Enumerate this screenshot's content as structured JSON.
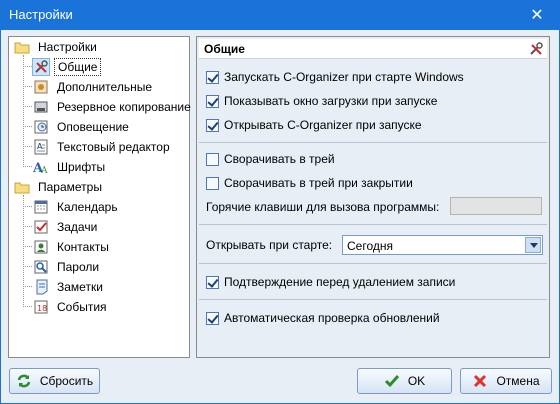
{
  "window": {
    "title": "Настройки",
    "close_glyph": "✕"
  },
  "tree": {
    "root1": "Настройки",
    "root1_children": [
      {
        "label": "Общие",
        "icon": "wrench-screwdriver-icon",
        "selected": true
      },
      {
        "label": "Дополнительные",
        "icon": "gear-icon"
      },
      {
        "label": "Резервное копирование",
        "icon": "backup-icon"
      },
      {
        "label": "Оповещение",
        "icon": "clock-icon"
      },
      {
        "label": "Текстовый редактор",
        "icon": "text-editor-icon"
      },
      {
        "label": "Шрифты",
        "icon": "font-icon"
      }
    ],
    "root2": "Параметры",
    "root2_children": [
      {
        "label": "Календарь",
        "icon": "calendar-icon"
      },
      {
        "label": "Задачи",
        "icon": "tasks-icon"
      },
      {
        "label": "Контакты",
        "icon": "contacts-icon"
      },
      {
        "label": "Пароли",
        "icon": "passwords-icon"
      },
      {
        "label": "Заметки",
        "icon": "notes-icon"
      },
      {
        "label": "События",
        "icon": "events-icon"
      }
    ]
  },
  "panel": {
    "title": "Общие",
    "opt_startup": {
      "label": "Запускать C-Organizer при старте Windows",
      "checked": true
    },
    "opt_splash": {
      "label": "Показывать окно загрузки при запуске",
      "checked": true
    },
    "opt_open": {
      "label": "Открывать C-Organizer при запуске",
      "checked": true
    },
    "opt_tray": {
      "label": "Сворачивать в трей",
      "checked": false
    },
    "opt_tray_close": {
      "label": "Сворачивать в трей при закрытии",
      "checked": false
    },
    "hotkey_label": "Горячие клавиши для вызова программы:",
    "hotkey_value": "",
    "open_label": "Открывать при старте:",
    "open_value": "Сегодня",
    "opt_confirm": {
      "label": "Подтверждение перед удалением записи",
      "checked": true
    },
    "opt_update": {
      "label": "Автоматическая проверка обновлений",
      "checked": true
    }
  },
  "buttons": {
    "reset": "Сбросить",
    "ok": "OK",
    "cancel": "Отмена"
  },
  "colors": {
    "titlebar": "#1a73d9",
    "dialog_bg": "#e7eef6",
    "selection": "#cde6fb"
  }
}
